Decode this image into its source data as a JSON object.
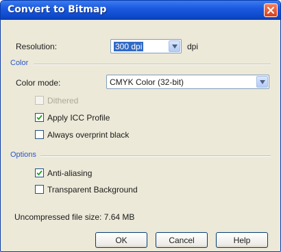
{
  "window": {
    "title": "Convert to Bitmap",
    "close_icon": "close-icon"
  },
  "resolution": {
    "label": "Resolution:",
    "value": "300 dpi",
    "unit": "dpi"
  },
  "color_section": {
    "title": "Color"
  },
  "color_mode": {
    "label": "Color mode:",
    "value": "CMYK Color (32-bit)"
  },
  "checkboxes": {
    "dithered": {
      "label": "Dithered",
      "checked": false,
      "enabled": false
    },
    "apply_icc": {
      "label": "Apply ICC Profile",
      "checked": true,
      "enabled": true
    },
    "overprint": {
      "label": "Always overprint black",
      "checked": false,
      "enabled": true
    }
  },
  "options_section": {
    "title": "Options"
  },
  "options": {
    "anti_aliasing": {
      "label": "Anti-aliasing",
      "checked": true
    },
    "transparent_bg": {
      "label": "Transparent Background",
      "checked": false
    }
  },
  "file_size": {
    "label": "Uncompressed file size: 7.64 MB"
  },
  "buttons": {
    "ok": "OK",
    "cancel": "Cancel",
    "help": "Help"
  },
  "colors": {
    "title_bar": "#1b5ae0",
    "dialog_bg": "#ece9d8",
    "accent": "#2b55c6",
    "selection": "#316ac5"
  }
}
